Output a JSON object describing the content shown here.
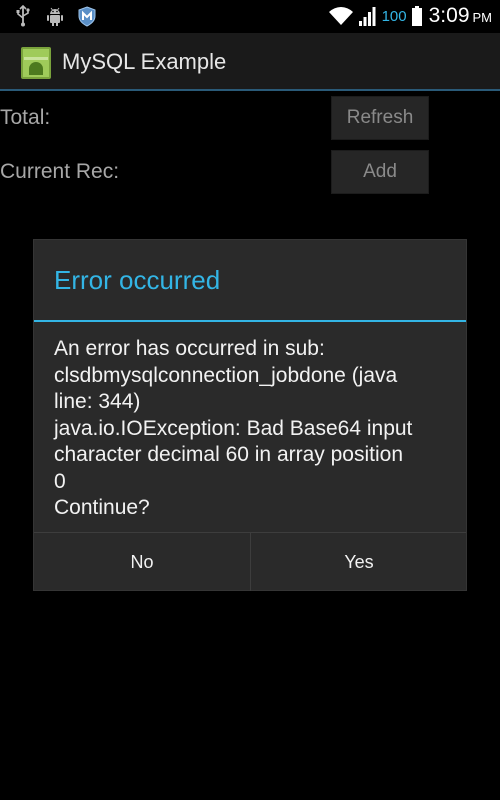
{
  "status_bar": {
    "battery_percent": "100",
    "time": "3:09",
    "ampm": "PM",
    "icons_left": [
      "usb-icon",
      "android-debug-icon",
      "security-icon"
    ],
    "icons_right": [
      "wifi-icon",
      "signal-icon",
      "battery-icon"
    ]
  },
  "action_bar": {
    "title": "MySQL Example",
    "icon": "app-launcher-icon"
  },
  "content": {
    "total_label": "Total:",
    "current_label": "Current Rec:",
    "refresh_label": "Refresh",
    "add_label": "Add"
  },
  "dialog": {
    "title": "Error occurred",
    "message_lines": [
      "An error has occurred in sub:",
      "clsdbmysqlconnection_jobdone (java",
      "line: 344)",
      "java.io.IOException: Bad Base64 input",
      "character decimal 60 in array position",
      "0",
      "Continue?"
    ],
    "no_label": "No",
    "yes_label": "Yes"
  },
  "colors": {
    "accent": "#33b5e5",
    "background": "#000000",
    "dialog_bg": "#2a2a2a"
  }
}
